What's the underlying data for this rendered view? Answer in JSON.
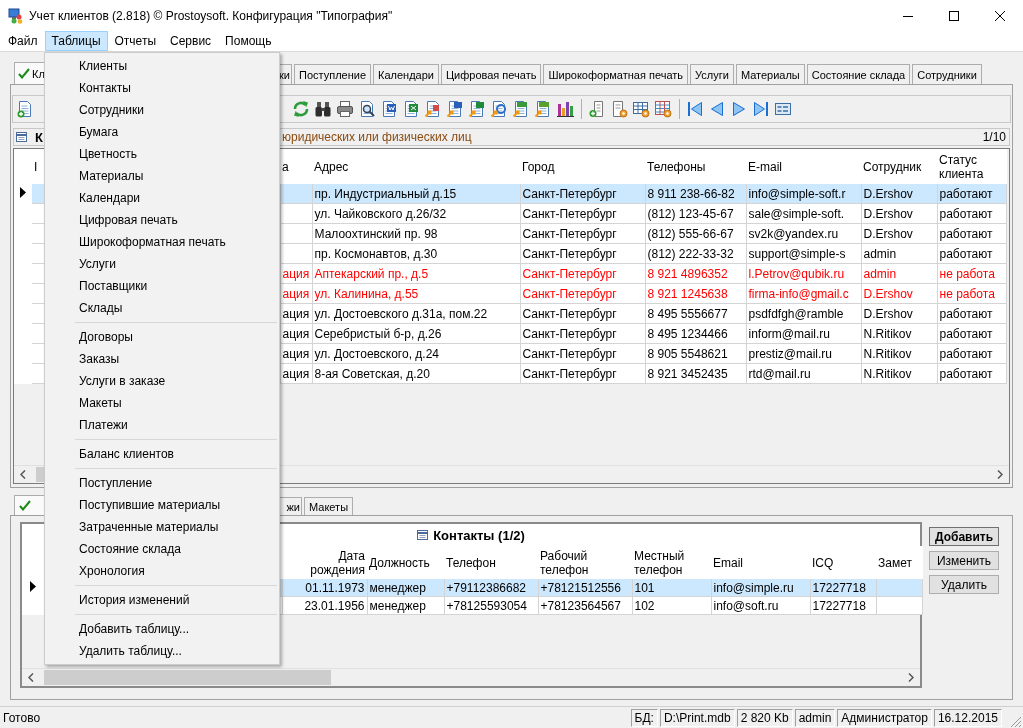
{
  "window": {
    "title": "Учет клиентов (2.818) © Prostoysoft. Конфигурация \"Типография\""
  },
  "menu_bar": [
    {
      "label": "Файл",
      "selected": false
    },
    {
      "label": "Таблицы",
      "selected": true
    },
    {
      "label": "Отчеты",
      "selected": false
    },
    {
      "label": "Сервис",
      "selected": false
    },
    {
      "label": "Помощь",
      "selected": false
    }
  ],
  "dropdown": {
    "groups": [
      [
        "Клиенты",
        "Контакты",
        "Сотрудники",
        "Бумага",
        "Цветность",
        "Материалы",
        "Календари",
        "Цифровая печать",
        "Широкоформатная печать",
        "Услуги",
        "Поставщики",
        "Склады"
      ],
      [
        "Договоры",
        "Заказы",
        "Услуги в заказе",
        "Макеты",
        "Платежи"
      ],
      [
        "Баланс клиентов"
      ],
      [
        "Поступление",
        "Поступившие материалы",
        "Затраченные материалы",
        "Состояние склада",
        "Хронология"
      ],
      [
        "История изменений"
      ],
      [
        "Добавить таблицу...",
        "Удалить таблицу..."
      ]
    ]
  },
  "tabs": [
    {
      "label": "Кл",
      "selected": true
    },
    {
      "label": "ки",
      "selected": false
    },
    {
      "label": "Поступление",
      "selected": false
    },
    {
      "label": "Календари",
      "selected": false
    },
    {
      "label": "Цифровая печать",
      "selected": false
    },
    {
      "label": "Широкоформатная печать",
      "selected": false
    },
    {
      "label": "Услуги",
      "selected": false
    },
    {
      "label": "Материалы",
      "selected": false
    },
    {
      "label": "Состояние склада",
      "selected": false
    },
    {
      "label": "Сотрудники",
      "selected": false
    }
  ],
  "clients": {
    "caption": "К",
    "subtitle": "юридических или физических лиц",
    "counter": "1/10",
    "columns": {
      "column_1": "I",
      "column_2": "а",
      "address": "Адрес",
      "city": "Город",
      "phones": "Телефоны",
      "email": "E-mail",
      "employee": "Сотрудник",
      "status": "Статус клиента"
    },
    "rows": [
      {
        "selected": true,
        "inactive": false,
        "address": "пр. Индустриальный д.15",
        "city": "Санкт-Петербург",
        "phones": "8 911 238-66-82",
        "email": "info@simple-soft.r",
        "employee": "D.Ershov",
        "status": "работают"
      },
      {
        "selected": false,
        "inactive": false,
        "address": "ул. Чайковского д.26/32",
        "city": "Санкт-Петербург",
        "phones": "(812) 123-45-67",
        "email": "sale@simple-soft.",
        "employee": "D.Ershov",
        "status": "работают"
      },
      {
        "selected": false,
        "inactive": false,
        "address": "Малоохтинский пр. 98",
        "city": "Санкт-Петербург",
        "phones": "(812) 555-66-67",
        "email": "sv2k@yandex.ru",
        "employee": "D.Ershov",
        "status": "работают"
      },
      {
        "selected": false,
        "inactive": false,
        "address": "пр. Космонавтов, д.30",
        "city": "Санкт-Петербург",
        "phones": "(812) 222-33-32",
        "email": "support@simple-s",
        "employee": "admin",
        "status": "работают"
      },
      {
        "selected": false,
        "inactive": true,
        "column_2": "ация",
        "address": "Аптекарский пр., д.5",
        "city": "Санкт-Петербург",
        "phones": "8 921 4896352",
        "email": "l.Petrov@qubik.ru",
        "employee": "admin",
        "status": "не работа"
      },
      {
        "selected": false,
        "inactive": true,
        "column_2": "ация",
        "address": "ул. Калинина, д.55",
        "city": "Санкт-Петербург",
        "phones": "8 921 1245638",
        "email": "firma-info@gmail.c",
        "employee": "D.Ershov",
        "status": "не работа"
      },
      {
        "selected": false,
        "inactive": false,
        "column_2": "ация",
        "address": "ул. Достоевского д.31а, пом.22",
        "city": "Санкт-Петербург",
        "phones": "8 495 5556677",
        "email": "psdfdfgh@ramble",
        "employee": "D.Ershov",
        "status": "работают"
      },
      {
        "selected": false,
        "inactive": false,
        "column_2": "ация",
        "address": "Серебристый б-р, д.26",
        "city": "Санкт-Петербург",
        "phones": "8 495 1234466",
        "email": "inform@mail.ru",
        "employee": "N.Ritikov",
        "status": "работают"
      },
      {
        "selected": false,
        "inactive": false,
        "column_2": "ация",
        "address": "ул. Достоевского, д.24",
        "city": "Санкт-Петербург",
        "phones": "8 905 5548621",
        "email": "prestiz@mail.ru",
        "employee": "N.Ritikov",
        "status": "работают"
      },
      {
        "selected": false,
        "inactive": false,
        "column_2": "ация",
        "address": "8-ая Советская, д.20",
        "city": "Санкт-Петербург",
        "phones": "8 921 3452435",
        "email": "rtd@mail.ru",
        "employee": "N.Ritikov",
        "status": "работают"
      }
    ]
  },
  "detail_tabs": [
    {
      "selected": true
    },
    {
      "label": "жи",
      "selected": false
    },
    {
      "label": "Макеты",
      "selected": false
    }
  ],
  "contacts": {
    "title": "Контакты (1/2)",
    "columns": {
      "birth_date": "Дата рождения",
      "position": "Должность",
      "phone": "Телефон",
      "work_phone": "Рабочий телефон",
      "local_phone": "Местный телефон",
      "email": "Email",
      "icq": "ICQ",
      "notes": "Замет"
    },
    "rows": [
      {
        "selected": true,
        "birth_date": "01.11.1973",
        "position": "менеджер",
        "phone": "+79112386682",
        "work_phone": "+78121512556",
        "local_phone": "101",
        "email": "info@simple.ru",
        "icq": "17227718"
      },
      {
        "selected": false,
        "birth_date": "23.01.1956",
        "position": "менеджер",
        "phone": "+78125593054",
        "work_phone": "+78123564567",
        "local_phone": "102",
        "email": "info@soft.ru",
        "icq": "17227718"
      }
    ]
  },
  "buttons": [
    {
      "label": "Добавить",
      "default": true
    },
    {
      "label": "Изменить",
      "default": false
    },
    {
      "label": "Удалить",
      "default": false
    }
  ],
  "status_bar": {
    "message": "Готово",
    "panels": [
      "БД:",
      "D:\\Print.mdb",
      "2 820 Kb",
      "admin",
      "Администратор",
      "16.12.2015"
    ]
  }
}
